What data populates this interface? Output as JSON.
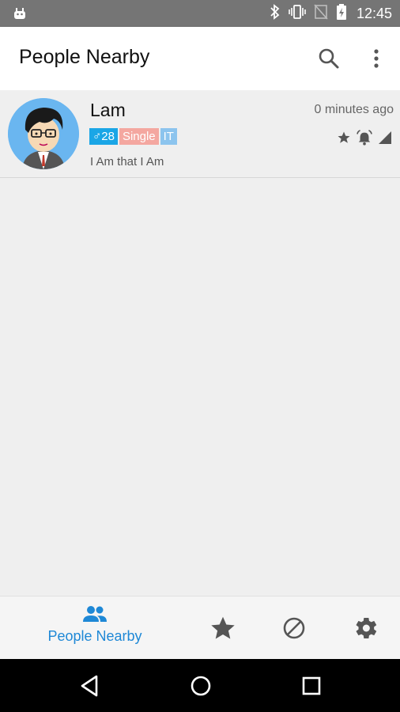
{
  "status_bar": {
    "time": "12:45"
  },
  "app_bar": {
    "title": "People Nearby"
  },
  "list": {
    "items": [
      {
        "name": "Lam",
        "time_ago": "0 minutes ago",
        "tags": {
          "age": "♂28",
          "status": "Single",
          "job": "IT"
        },
        "bio": "I Am that I Am"
      }
    ]
  },
  "bottom_nav": {
    "people_nearby_label": "People Nearby",
    "active_color": "#1e88d6"
  }
}
